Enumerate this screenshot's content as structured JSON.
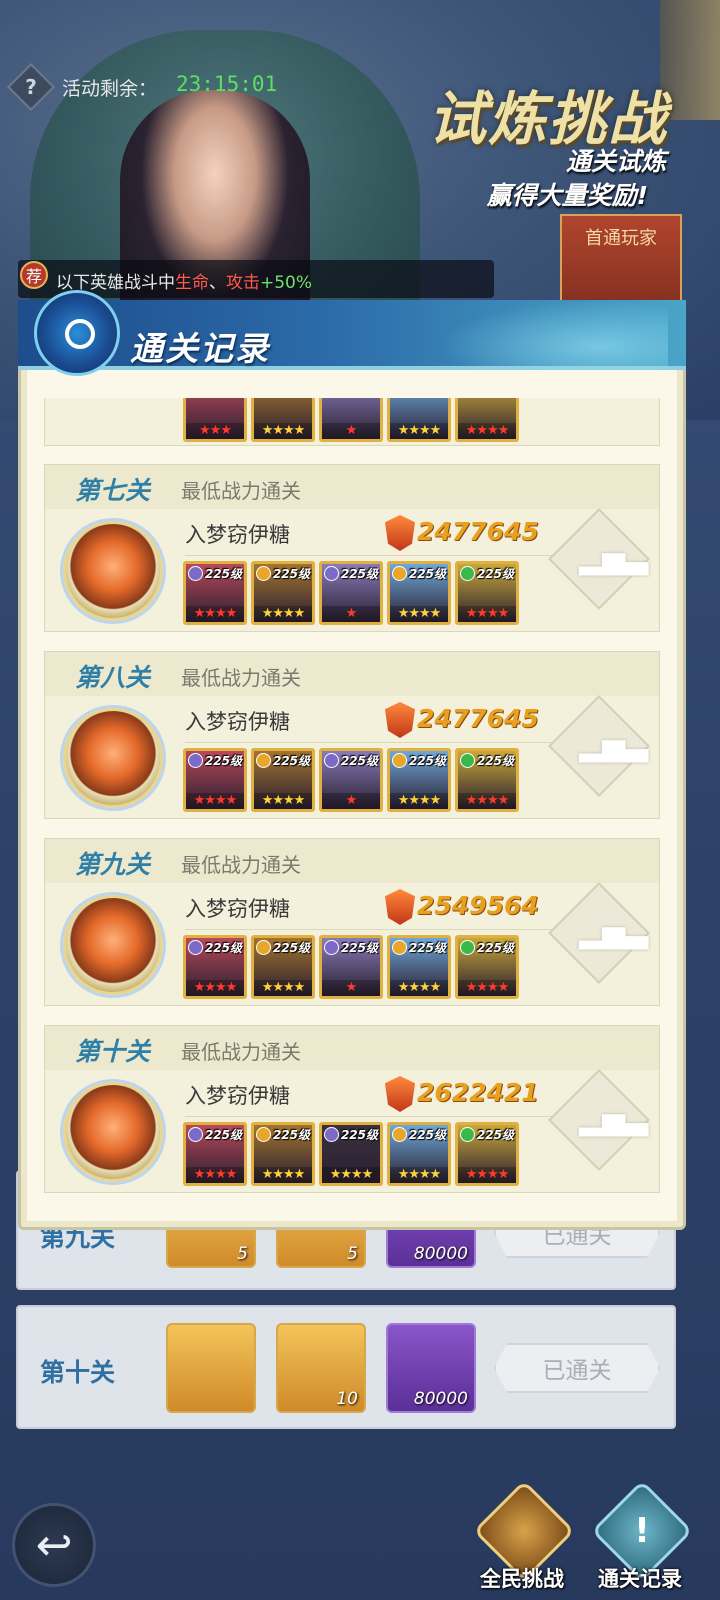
{
  "event": {
    "timer_label": "活动剩余：",
    "timer_value": "23:15:01",
    "title": "试炼挑战",
    "subtitle_line1": "通关试炼",
    "subtitle_line2": "赢得大量奖励!",
    "first_player_label": "首通玩家",
    "recommend_badge": "荐",
    "bonus_prefix": "以下英雄战斗中",
    "bonus_stat1": "生命",
    "bonus_sep": "、",
    "bonus_stat2": "攻击",
    "bonus_value": "+50%"
  },
  "dialog": {
    "title": "通关记录",
    "records": [
      {
        "level": "第七关",
        "desc": "最低战力通关",
        "player": "入梦窃伊糖",
        "power": "2477645",
        "heroes": [
          {
            "level": "225级",
            "element_color": "#7b6ac8",
            "stars": "★★★★",
            "star_color": "red",
            "bg": "#b8495a"
          },
          {
            "level": "225级",
            "element_color": "#e8a62a",
            "stars": "★★★★",
            "star_color": "gold",
            "bg": "#a3742e"
          },
          {
            "level": "225级",
            "element_color": "#7b6ac8",
            "stars": "★",
            "star_color": "red",
            "bg": "#8a7ab8"
          },
          {
            "level": "225级",
            "element_color": "#e8a62a",
            "stars": "★★★★",
            "star_color": "gold",
            "bg": "#6fa8d8"
          },
          {
            "level": "225级",
            "element_color": "#3ab84a",
            "stars": "★★★★",
            "star_color": "red",
            "bg": "#c9a83a"
          }
        ]
      },
      {
        "level": "第八关",
        "desc": "最低战力通关",
        "player": "入梦窃伊糖",
        "power": "2477645",
        "heroes": [
          {
            "level": "225级",
            "element_color": "#7b6ac8",
            "stars": "★★★★",
            "star_color": "red",
            "bg": "#b8495a"
          },
          {
            "level": "225级",
            "element_color": "#e8a62a",
            "stars": "★★★★",
            "star_color": "gold",
            "bg": "#a3742e"
          },
          {
            "level": "225级",
            "element_color": "#7b6ac8",
            "stars": "★",
            "star_color": "red",
            "bg": "#8a7ab8"
          },
          {
            "level": "225级",
            "element_color": "#e8a62a",
            "stars": "★★★★",
            "star_color": "gold",
            "bg": "#6fa8d8"
          },
          {
            "level": "225级",
            "element_color": "#3ab84a",
            "stars": "★★★★",
            "star_color": "red",
            "bg": "#c9a83a"
          }
        ]
      },
      {
        "level": "第九关",
        "desc": "最低战力通关",
        "player": "入梦窃伊糖",
        "power": "2549564",
        "heroes": [
          {
            "level": "225级",
            "element_color": "#7b6ac8",
            "stars": "★★★★",
            "star_color": "red",
            "bg": "#b8495a"
          },
          {
            "level": "225级",
            "element_color": "#e8a62a",
            "stars": "★★★★",
            "star_color": "gold",
            "bg": "#a3742e"
          },
          {
            "level": "225级",
            "element_color": "#7b6ac8",
            "stars": "★",
            "star_color": "red",
            "bg": "#8a7ab8"
          },
          {
            "level": "225级",
            "element_color": "#e8a62a",
            "stars": "★★★★",
            "star_color": "gold",
            "bg": "#6fa8d8"
          },
          {
            "level": "225级",
            "element_color": "#3ab84a",
            "stars": "★★★★",
            "star_color": "red",
            "bg": "#c9a83a"
          }
        ]
      },
      {
        "level": "第十关",
        "desc": "最低战力通关",
        "player": "入梦窃伊糖",
        "power": "2622421",
        "heroes": [
          {
            "level": "225级",
            "element_color": "#7b6ac8",
            "stars": "★★★★",
            "star_color": "red",
            "bg": "#b8495a"
          },
          {
            "level": "225级",
            "element_color": "#e8a62a",
            "stars": "★★★★",
            "star_color": "gold",
            "bg": "#a3742e"
          },
          {
            "level": "225级",
            "element_color": "#7b6ac8",
            "stars": "★★★★",
            "star_color": "gold",
            "bg": "#3a3040"
          },
          {
            "level": "225级",
            "element_color": "#e8a62a",
            "stars": "★★★★",
            "star_color": "gold",
            "bg": "#6fa8d8"
          },
          {
            "level": "225级",
            "element_color": "#3ab84a",
            "stars": "★★★★",
            "star_color": "red",
            "bg": "#c9a83a"
          }
        ]
      }
    ],
    "partial_top_stars": [
      "★★★",
      "★★★★",
      "★",
      "★★★★",
      "★★★★"
    ]
  },
  "background_list": {
    "row9": {
      "level": "第九关",
      "counts": [
        "5",
        "5",
        "80000"
      ],
      "status": "已通关"
    },
    "row10": {
      "level": "第十关",
      "counts": [
        "",
        "10",
        "80000"
      ],
      "status": "已通关"
    }
  },
  "nav": {
    "all_challenge": "全民挑战",
    "records": "通关记录"
  }
}
